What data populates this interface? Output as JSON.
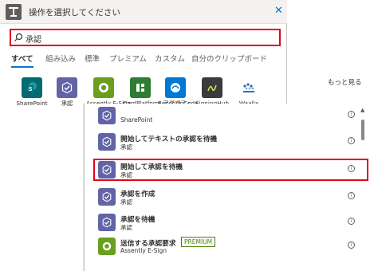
{
  "header": {
    "title": "操作を選択してください",
    "close": "✕"
  },
  "search": {
    "value": "承認"
  },
  "tabs": [
    "すべて",
    "組み込み",
    "標準",
    "プレミアム",
    "カスタム",
    "自分のクリップボード"
  ],
  "connectors": [
    {
      "label": "SharePoint",
      "icon": "sharepoint-icon",
      "color": "#036c70"
    },
    {
      "label": "承認",
      "icon": "approvals-icon",
      "color": "#6264a7"
    },
    {
      "label": "Assently E-Sign",
      "icon": "assently-icon",
      "color": "#6a9e1f"
    },
    {
      "label": "CardPlatform アダプティ...",
      "icon": "cardplatform-icon",
      "color": "#2e7d32"
    },
    {
      "label": "Rencore Code",
      "icon": "rencore-icon",
      "color": "#0078d4"
    },
    {
      "label": "SigningHub",
      "icon": "signinghub-icon",
      "color": "#3b3b3b"
    },
    {
      "label": "Waalla",
      "icon": "waalla-icon",
      "color": "#2f6fb0"
    }
  ],
  "more_link": "もっと見る",
  "actions": [
    {
      "title": "",
      "sub": "SharePoint",
      "icon": "approvals-icon"
    },
    {
      "title": "開始してテキストの承認を待機",
      "sub": "承認",
      "icon": "approvals-icon"
    },
    {
      "title": "開始して承認を待機",
      "sub": "承認",
      "icon": "approvals-icon"
    },
    {
      "title": "承認を作成",
      "sub": "承認",
      "icon": "approvals-icon"
    },
    {
      "title": "承認を待機",
      "sub": "承認",
      "icon": "approvals-icon"
    },
    {
      "title": "送信する承認要求",
      "sub": "Assently E-Sign",
      "icon": "assently-icon",
      "badge": "PREMIUM"
    }
  ],
  "info_glyph": "i",
  "colors": {
    "accent": "#0078d4",
    "highlight": "#e3001b",
    "approvals": "#6264a7",
    "premium": "#498205"
  }
}
